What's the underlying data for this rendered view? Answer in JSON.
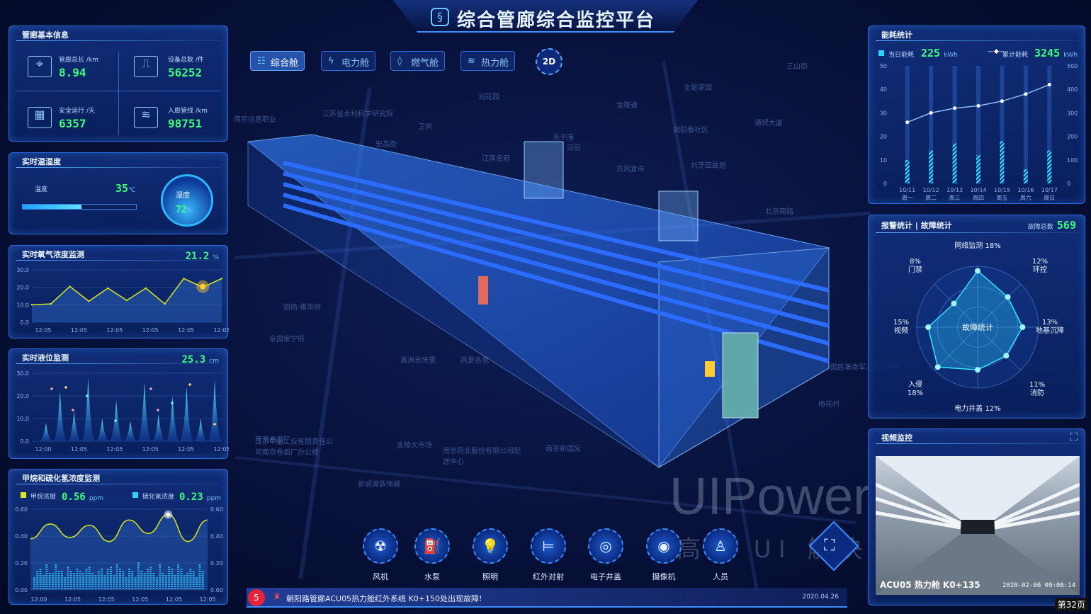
{
  "header": {
    "title": "综合管廊综合监控平台"
  },
  "tabs": [
    {
      "label": "综合舱",
      "icon": "grid-icon"
    },
    {
      "label": "电力舱",
      "icon": "bolt-icon"
    },
    {
      "label": "燃气舱",
      "icon": "flame-icon"
    },
    {
      "label": "热力舱",
      "icon": "heat-icon"
    }
  ],
  "view_toggle": "2D",
  "basic_info": {
    "title": "管廊基本信息",
    "items": [
      {
        "label": "管廊总长 /km",
        "value": "8.94"
      },
      {
        "label": "设备总数 /件",
        "value": "56252"
      },
      {
        "label": "安全运行 /天",
        "value": "6357"
      },
      {
        "label": "入廊管线 /km",
        "value": "98751"
      }
    ]
  },
  "temp_humidity": {
    "title": "实时温湿度",
    "temp_label": "温度",
    "temp_value": "35",
    "temp_unit": "℃",
    "humidity_label": "湿度",
    "humidity_value": "72",
    "humidity_unit": "%"
  },
  "oxygen": {
    "title": "实时氧气浓度监测",
    "value": "21.2",
    "unit": "%"
  },
  "liquid": {
    "title": "实时液位监测",
    "value": "25.3",
    "unit": "cm"
  },
  "gas": {
    "title": "甲烷和硫化氢浓度监测",
    "methane_label": "甲烷浓度",
    "methane_value": "0.56",
    "methane_unit": "ppm",
    "h2s_label": "硫化氢浓度",
    "h2s_value": "0.23",
    "h2s_unit": "ppm"
  },
  "energy": {
    "title": "能耗统计",
    "daily_label": "当日能耗",
    "daily_value": "225",
    "daily_unit": "kWh",
    "total_label": "累计能耗",
    "total_value": "3245",
    "total_unit": "kWh"
  },
  "alarm": {
    "title_a": "报警统计",
    "sep": "|",
    "title_b": "故障统计",
    "total_label": "故障总数",
    "total_value": "569",
    "center": "故障统计"
  },
  "video": {
    "title": "视频监控",
    "caption": "ACU05 热力舱  K0+135",
    "timestamp": "2020-02-06 09:08:14"
  },
  "devices": [
    {
      "label": "风机",
      "icon": "fan-icon",
      "glyph": "☢"
    },
    {
      "label": "水泵",
      "icon": "pump-icon",
      "glyph": "⛽"
    },
    {
      "label": "照明",
      "icon": "light-icon",
      "glyph": "💡"
    },
    {
      "label": "红外对射",
      "icon": "infrared-icon",
      "glyph": "⊨"
    },
    {
      "label": "电子井盖",
      "icon": "manhole-icon",
      "glyph": "◎"
    },
    {
      "label": "摄像机",
      "icon": "camera-icon",
      "glyph": "◉"
    },
    {
      "label": "人员",
      "icon": "person-icon",
      "glyph": "♙"
    }
  ],
  "alert_bar": {
    "count": "5",
    "message": "朝阳路管廊ACU05热力舱红外系统 K0+150处出现故障!",
    "date": "2020.04.26"
  },
  "watermark": {
    "text": "UIPower",
    "subtext": "高端 UI 解决 专家"
  },
  "page_indicator": "第32页",
  "map_labels": [
    "江苏省水利科学研究院",
    "润花园",
    "南京信息职业",
    "卫岗",
    "汉府",
    "江南名府",
    "古风倉市",
    "刘芝田故居",
    "三山街",
    "安品街",
    "金陵道",
    "全是家园",
    "朝阳巷社区",
    "通贸大厦",
    "夫子庙",
    "北京南路",
    "招商·雍华府",
    "全国家宁府",
    "禹洲吉庆里",
    "风景名苑",
    "金陵大市场",
    "南京卷烟厂",
    "亚东国际公寓",
    "南京新国际",
    "江苏中烟工业有限责任公司南京卷烟厂办公楼",
    "南京药业股份有限公司配送中心",
    "新城源装饰城",
    "梅花村",
    "国民革命军工专门学校"
  ],
  "chart_data": [
    {
      "type": "line",
      "title": "实时氧气浓度监测",
      "categories": [
        "12:05",
        "12:05",
        "12:05",
        "12:05",
        "12:05",
        "12:05"
      ],
      "ylim": [
        0,
        30
      ],
      "yticks": [
        0,
        10,
        20,
        30
      ],
      "series": [
        {
          "values": [
            10,
            10.5,
            20.5,
            12,
            19.5,
            12.5,
            19.5,
            10.5,
            25,
            20,
            25
          ]
        }
      ]
    },
    {
      "type": "area",
      "title": "实时液位监测",
      "categories": [
        "12:00",
        "12:05",
        "12:05",
        "12:05",
        "12:05",
        "12:05"
      ],
      "ylim": [
        0,
        30
      ],
      "yticks": [
        0,
        10,
        20,
        30
      ],
      "series": [
        {
          "values": [
            8,
            22,
            13,
            28,
            10,
            18,
            9,
            26,
            12,
            20,
            24,
            10,
            27
          ]
        }
      ]
    },
    {
      "type": "line",
      "title": "甲烷和硫化氢浓度监测",
      "categories": [
        "12:00",
        "12:05",
        "12:05",
        "12:05",
        "12:05",
        "12:05"
      ],
      "ylim": [
        0,
        0.6
      ],
      "yticks": [
        0,
        0.2,
        0.4,
        0.6
      ],
      "series": [
        {
          "name": "甲烷浓度",
          "values": [
            0.38,
            0.49,
            0.39,
            0.48,
            0.36,
            0.52,
            0.42,
            0.56,
            0.36,
            0.52
          ]
        },
        {
          "name": "硫化氢浓度",
          "values": [
            0.2,
            0.18,
            0.23,
            0.19,
            0.21,
            0.17,
            0.22,
            0.2,
            0.18,
            0.23,
            0.19,
            0.21,
            0.2,
            0.22,
            0.18,
            0.2
          ]
        }
      ]
    },
    {
      "type": "bar",
      "title": "能耗统计",
      "categories": [
        "10/11 周一",
        "10/12 周二",
        "10/13 周三",
        "10/14 周四",
        "10/15 周五",
        "10/16 周六",
        "10/17 周日"
      ],
      "ylim": [
        0,
        50
      ],
      "y2lim": [
        0,
        500
      ],
      "yticks": [
        0,
        10,
        20,
        30,
        40,
        50
      ],
      "y2ticks": [
        0,
        100,
        200,
        300,
        400,
        500
      ],
      "series": [
        {
          "name": "当日能耗",
          "values": [
            10,
            14,
            17,
            12,
            18,
            6,
            14
          ]
        },
        {
          "name": "累计能耗",
          "values": [
            260,
            300,
            320,
            330,
            350,
            380,
            420
          ]
        }
      ]
    },
    {
      "type": "radar",
      "title": "故障统计",
      "categories": [
        "网络监测 18%",
        "环控 12%",
        "地基沉降 13%",
        "消防 11%",
        "电力井盖 12%",
        "入侵 18%",
        "视频 15%",
        "门禁 8%"
      ],
      "series": [
        {
          "values": [
            18,
            12,
            13,
            11,
            12,
            18,
            15,
            8
          ]
        }
      ]
    }
  ]
}
